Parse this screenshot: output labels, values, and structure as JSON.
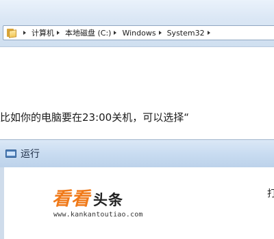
{
  "explorer": {
    "breadcrumb": [
      "计算机",
      "本地磁盘 (C:)",
      "Windows",
      "System32"
    ]
  },
  "article": {
    "sentence": "比如你的电脑要在23:00关机，可以选择“"
  },
  "run_dialog": {
    "title": "运行",
    "open_label_fragment": "打"
  },
  "watermark": {
    "name_orange": "看看",
    "name_dark": "头条",
    "url": "www.kankantoutiao.com"
  },
  "colors": {
    "watermark_orange": "#f07a1a",
    "titlebar": "#c9dcf1"
  }
}
